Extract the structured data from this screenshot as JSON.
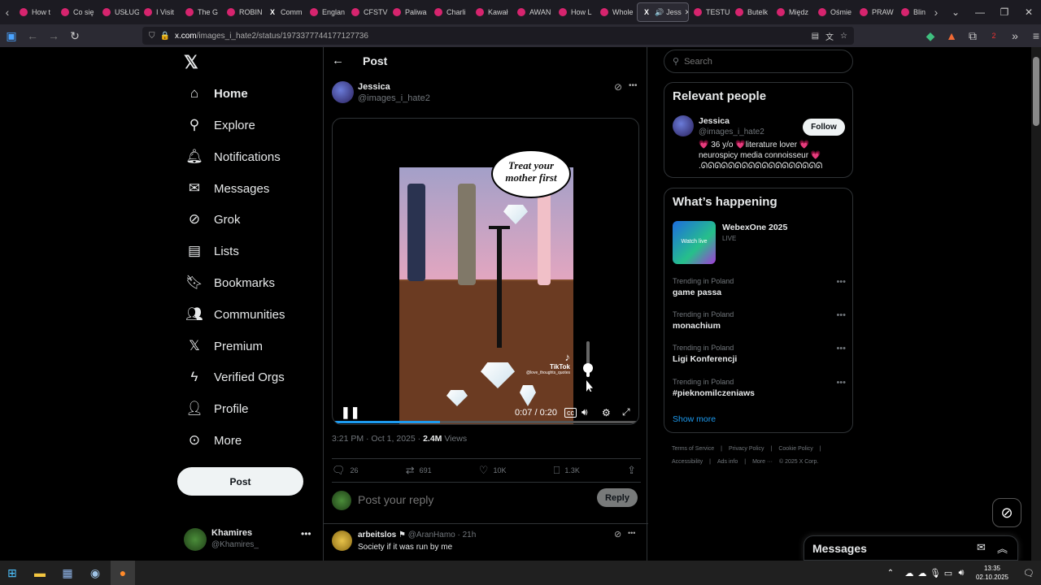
{
  "browser": {
    "tabs": [
      {
        "label": "How t"
      },
      {
        "label": "Co się"
      },
      {
        "label": "USŁUG"
      },
      {
        "label": "I Visit"
      },
      {
        "label": "The G"
      },
      {
        "label": "ROBIN"
      },
      {
        "label": "Comm"
      },
      {
        "label": "Englan"
      },
      {
        "label": "CFSTV"
      },
      {
        "label": "Paliwa"
      },
      {
        "label": "Charli"
      },
      {
        "label": "Kawał"
      },
      {
        "label": "AWAN"
      },
      {
        "label": "How L"
      },
      {
        "label": "Whole"
      },
      {
        "label": "Jess"
      },
      {
        "label": "TESTU"
      },
      {
        "label": "Butelk"
      },
      {
        "label": "Międz"
      },
      {
        "label": "Ośmie"
      },
      {
        "label": "PRAW"
      },
      {
        "label": "Blin"
      }
    ],
    "url_host": "x.com",
    "url_path": "/images_i_hate2/status/1973377744177127736",
    "extension_badge": "2"
  },
  "nav": {
    "home": "Home",
    "explore": "Explore",
    "notifications": "Notifications",
    "messages": "Messages",
    "grok": "Grok",
    "lists": "Lists",
    "bookmarks": "Bookmarks",
    "communities": "Communities",
    "premium": "Premium",
    "verified_orgs": "Verified Orgs",
    "profile": "Profile",
    "more": "More",
    "post_button": "Post",
    "account_name": "Khamires",
    "account_handle": "@Khamires_"
  },
  "post": {
    "header_title": "Post",
    "author_name": "Jessica",
    "author_handle": "@images_i_hate2",
    "video_caption": "Treat your mother first",
    "tiktok_label": "TikTok",
    "tiktok_user": "@love_thoughts_quotes",
    "video_time": "0:07 / 0:20",
    "video_progress": 0.35,
    "volume_level": 0.25,
    "timestamp": "3:21 PM · Oct 1, 2025 · ",
    "views_count": "2.4M",
    "views_label": " Views",
    "replies": "26",
    "reposts": "691",
    "likes": "10K",
    "bookmarks": "1.3K",
    "reply_placeholder": "Post your reply",
    "reply_button": "Reply"
  },
  "reply": {
    "name": "arbeitslos",
    "handle": "@AranHamo · 21h",
    "text": "Society if it was run by me"
  },
  "sidebar": {
    "search_placeholder": "Search",
    "relevant_title": "Relevant people",
    "relevant_name": "Jessica",
    "relevant_handle": "@images_i_hate2",
    "follow_button": "Follow",
    "bio": "💗 36 y/o 💗literature lover 💗 neurospicy media connoisseur 💗 .ᘏᘏᘏᘏᘏᘏᘏᘏᘏᘏᘏᘏᘏᘏᘏᘏᘏᘏ",
    "happening_title": "What’s happening",
    "event_title": "WebexOne 2025",
    "event_status": "LIVE",
    "event_thumb_label": "Watch live",
    "trends": [
      {
        "context": "Trending in Poland",
        "title": "game passa"
      },
      {
        "context": "Trending in Poland",
        "title": "monachium"
      },
      {
        "context": "Trending in Poland",
        "title": "Ligi Konferencji"
      },
      {
        "context": "Trending in Poland",
        "title": "#pieknomilczeniaws"
      }
    ],
    "show_more": "Show more",
    "footer": [
      "Terms of Service",
      "|",
      "Privacy Policy",
      "|",
      "Cookie Policy",
      "|",
      "Accessibility",
      "|",
      "Ads info",
      "|",
      "More ···",
      "© 2025 X Corp."
    ]
  },
  "messages_drawer": {
    "title": "Messages"
  },
  "taskbar": {
    "time": "13:35",
    "date": "02.10.2025"
  },
  "colors": {
    "accent": "#1d9bf0",
    "bg": "#000000",
    "border": "#2f3336",
    "muted": "#71767b"
  }
}
